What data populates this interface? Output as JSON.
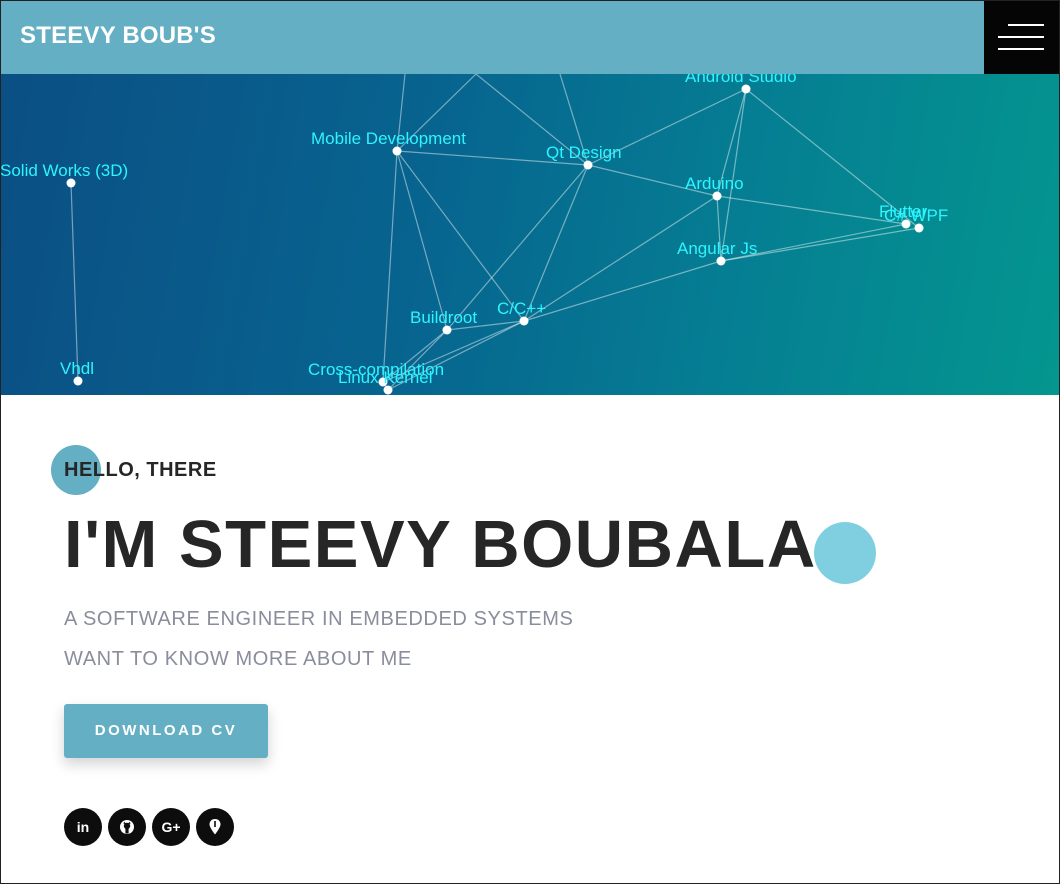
{
  "header": {
    "brand": "STEEVY BOUB'S",
    "menu_icon": "hamburger-menu-icon"
  },
  "skills_network": {
    "nodes": [
      {
        "id": "solid",
        "label": "Solid Works (3D)"
      },
      {
        "id": "vhdl",
        "label": "Vhdl"
      },
      {
        "id": "mobile",
        "label": "Mobile Development"
      },
      {
        "id": "qt",
        "label": "Qt Design"
      },
      {
        "id": "android",
        "label": "Android Studio"
      },
      {
        "id": "arduino",
        "label": "Arduino"
      },
      {
        "id": "angular",
        "label": "Angular Js"
      },
      {
        "id": "flutter",
        "label": "Flutter"
      },
      {
        "id": "wpf",
        "label": "C# WPF"
      },
      {
        "id": "buildroot",
        "label": "Buildroot"
      },
      {
        "id": "cpp",
        "label": "C/C++"
      },
      {
        "id": "cross",
        "label": "Cross-compilation"
      },
      {
        "id": "kernel",
        "label": "Linux Kernel"
      }
    ],
    "edges": [
      [
        "solid",
        "vhdl"
      ],
      [
        "mobile",
        "qt"
      ],
      [
        "mobile",
        "buildroot"
      ],
      [
        "mobile",
        "cpp"
      ],
      [
        "mobile",
        "cross"
      ],
      [
        "qt",
        "android"
      ],
      [
        "qt",
        "arduino"
      ],
      [
        "qt",
        "cpp"
      ],
      [
        "qt",
        "buildroot"
      ],
      [
        "android",
        "arduino"
      ],
      [
        "android",
        "angular"
      ],
      [
        "android",
        "wpf"
      ],
      [
        "arduino",
        "flutter"
      ],
      [
        "arduino",
        "angular"
      ],
      [
        "arduino",
        "cpp"
      ],
      [
        "angular",
        "flutter"
      ],
      [
        "angular",
        "wpf"
      ],
      [
        "angular",
        "cpp"
      ],
      [
        "buildroot",
        "cpp"
      ],
      [
        "buildroot",
        "cross"
      ],
      [
        "buildroot",
        "kernel"
      ],
      [
        "cpp",
        "cross"
      ],
      [
        "cpp",
        "kernel"
      ],
      [
        "cross",
        "kernel"
      ]
    ]
  },
  "hero": {
    "greeting": "HELLO, THERE",
    "headline": "I'M STEEVY BOUBALA",
    "subtitle_1": "A SOFTWARE ENGINEER IN EMBEDDED SYSTEMS",
    "subtitle_2": "WANT TO KNOW MORE ABOUT ME",
    "cta_label": "DOWNLOAD CV"
  },
  "socials": [
    {
      "name": "linkedin",
      "icon": "linkedin-icon",
      "text": "in"
    },
    {
      "name": "github",
      "icon": "github-icon"
    },
    {
      "name": "google-plus",
      "icon": "google-plus-icon",
      "text": "G+"
    },
    {
      "name": "location",
      "icon": "map-pin-icon"
    }
  ],
  "colors": {
    "accent": "#64afc3",
    "accent_light": "#7fcfe0",
    "node_label": "#2cf5ff",
    "heading": "#262626",
    "subtext": "#8a8d9c"
  }
}
